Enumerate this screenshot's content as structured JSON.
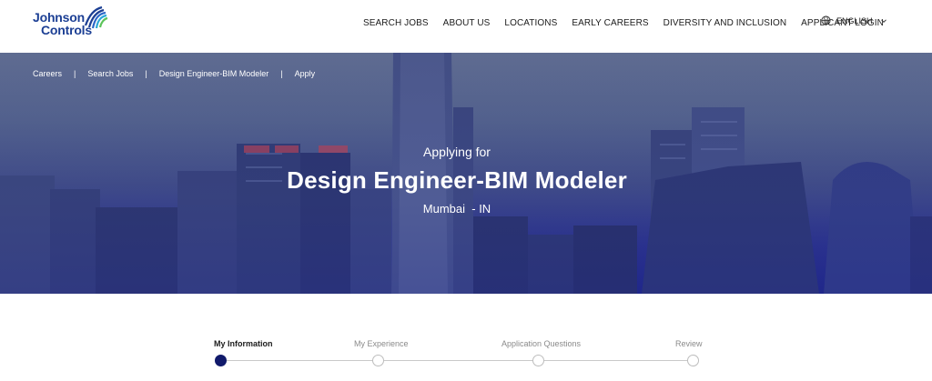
{
  "brand": {
    "line1": "Johnson",
    "line2": "Controls",
    "accent": "#1c3f94"
  },
  "nav": {
    "items": [
      "SEARCH JOBS",
      "ABOUT US",
      "LOCATIONS",
      "EARLY CAREERS",
      "DIVERSITY AND INCLUSION",
      "APPLICANT LOGIN"
    ],
    "language": "ENGLISH"
  },
  "breadcrumb": {
    "items": [
      "Careers",
      "Search Jobs",
      "Design Engineer-BIM Modeler",
      "Apply"
    ],
    "separator": "|"
  },
  "hero": {
    "kicker": "Applying for",
    "title": "Design Engineer-BIM Modeler",
    "location": "Mumbai  - IN"
  },
  "steps": {
    "items": [
      "My Information",
      "My Experience",
      "Application Questions",
      "Review"
    ],
    "active_color": "#111a6b"
  }
}
